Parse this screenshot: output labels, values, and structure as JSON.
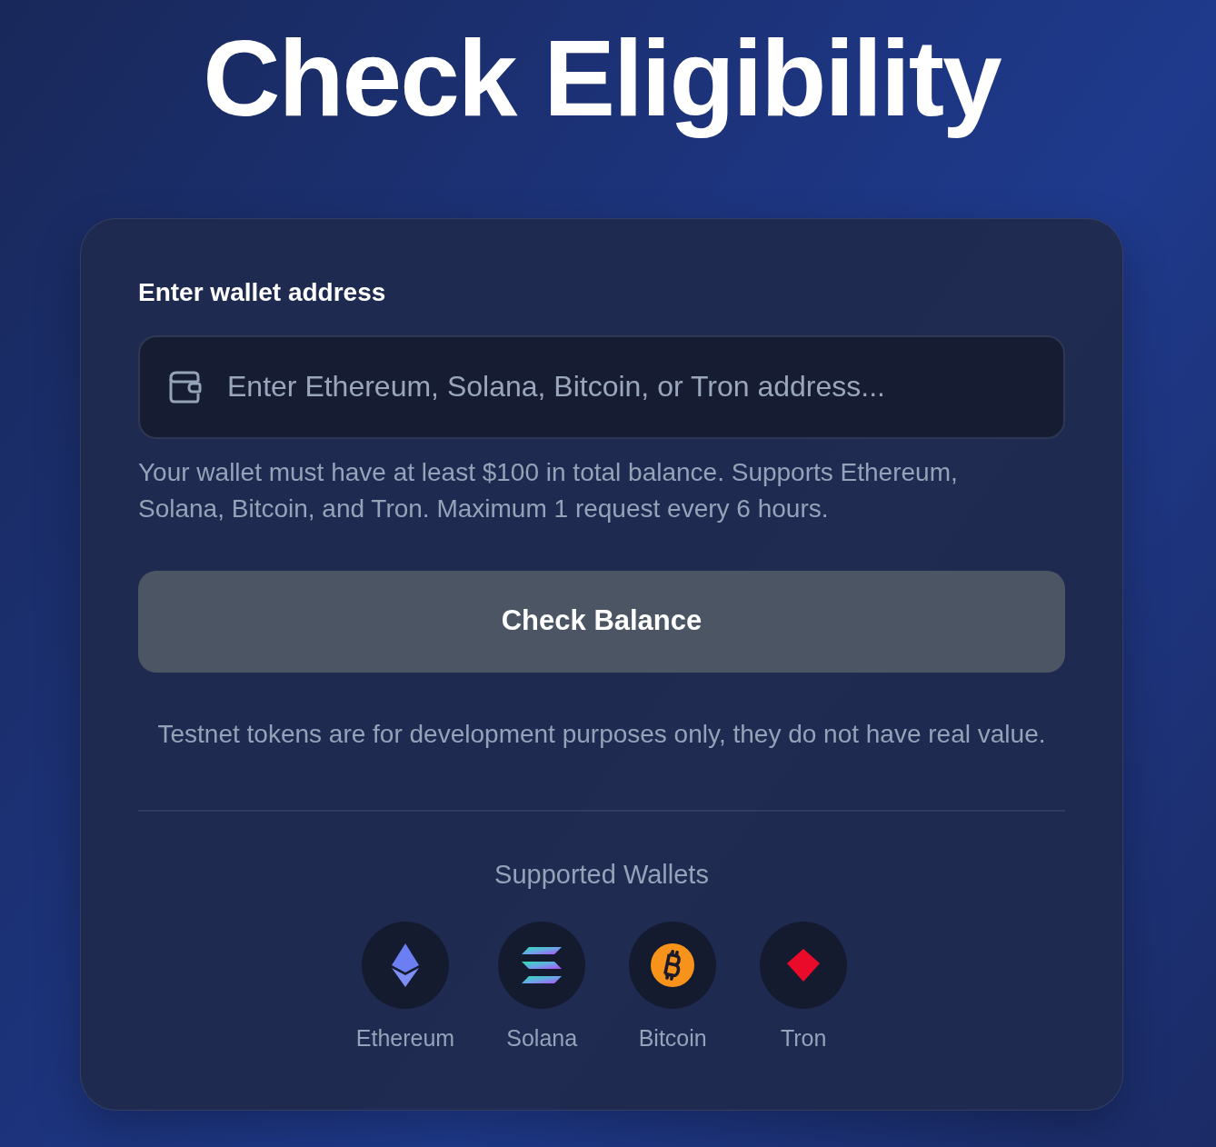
{
  "title": "Check Eligibility",
  "form": {
    "label": "Enter wallet address",
    "address_field": {
      "placeholder": "Enter Ethereum, Solana, Bitcoin, or Tron address..."
    },
    "help_text": "Your wallet must have at least $100 in total balance. Supports Ethereum, Solana, Bitcoin, and Tron. Maximum 1 request every 6 hours.",
    "button": {
      "label": "Check Balance",
      "disabled": true
    },
    "disclaimer": "Testnet tokens are for development purposes only, they do not have real value."
  },
  "supported": {
    "heading": "Supported Wallets",
    "wallets": [
      {
        "name": "Ethereum",
        "kind": "ethereum"
      },
      {
        "name": "Solana",
        "kind": "solana"
      },
      {
        "name": "Bitcoin",
        "kind": "bitcoin"
      },
      {
        "name": "Tron",
        "kind": "tron"
      }
    ]
  }
}
